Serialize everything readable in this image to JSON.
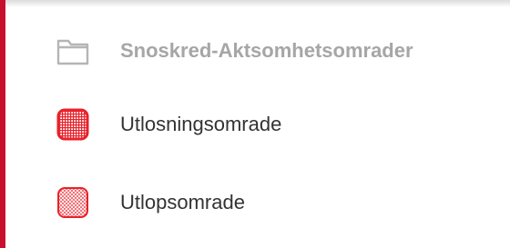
{
  "legend": {
    "group": {
      "label": "Snoskred-Aktsomhetsomrader",
      "icon": "folder-icon"
    },
    "layers": [
      {
        "label": "Utlosningsomrade",
        "icon": "grid-pattern-swatch-icon",
        "color": "#e8222b"
      },
      {
        "label": "Utlopsomrade",
        "icon": "dot-pattern-swatch-icon",
        "color": "#e8222b"
      }
    ]
  },
  "colors": {
    "accent": "#c8102e",
    "group_text": "#a6a6a6",
    "layer_text": "#333333"
  }
}
